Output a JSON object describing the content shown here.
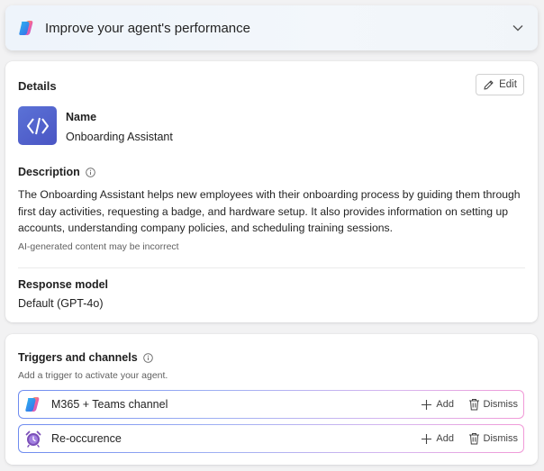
{
  "banner": {
    "title": "Improve your agent's performance",
    "logo_icon": "copilot-logo-icon",
    "chevron_icon": "chevron-down-icon"
  },
  "details": {
    "section_title": "Details",
    "edit_label": "Edit",
    "agent_icon": "code-brackets-icon",
    "name_label": "Name",
    "name_value": "Onboarding Assistant",
    "description_label": "Description",
    "description_text": "The Onboarding Assistant helps new employees with their onboarding process by guiding them through first day activities, requesting a badge, and hardware setup. It also provides information on setting up accounts, understanding company policies, and scheduling training sessions.",
    "ai_note": "AI-generated content may be incorrect",
    "response_model_label": "Response model",
    "response_model_value": "Default (GPT-4o)"
  },
  "triggers": {
    "section_title": "Triggers and channels",
    "subtitle": "Add a trigger to activate your agent.",
    "items": [
      {
        "label": "M365 + Teams channel",
        "icon": "copilot-logo-icon",
        "add_label": "Add",
        "dismiss_label": "Dismiss"
      },
      {
        "label": "Re-occurence",
        "icon": "alarm-clock-icon",
        "add_label": "Add",
        "dismiss_label": "Dismiss"
      }
    ]
  },
  "colors": {
    "accent_avatar": "#4a55c4",
    "border_gradient_start": "#6f8cf0",
    "border_gradient_end": "#f19ad8",
    "alarm_purple": "#7b4fb8"
  }
}
